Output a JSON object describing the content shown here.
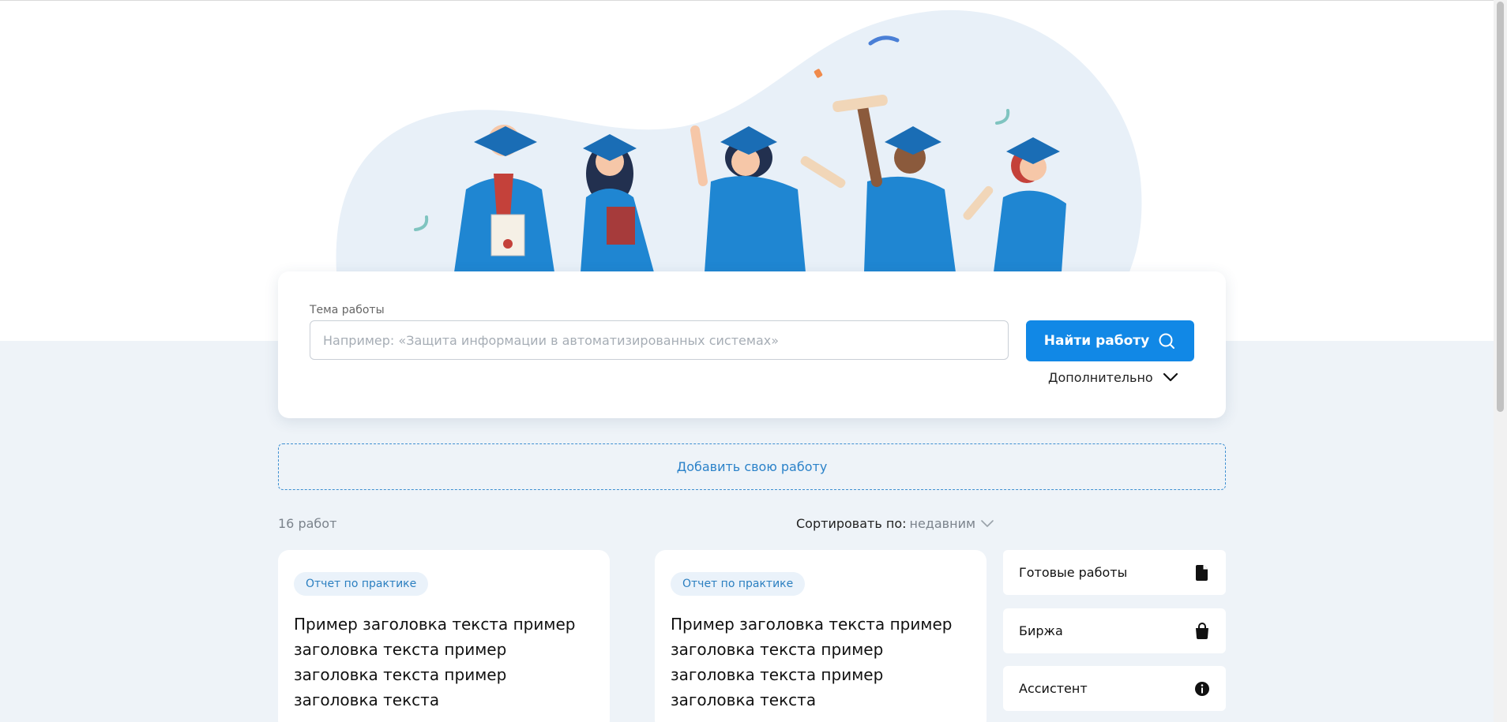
{
  "search": {
    "label": "Тема работы",
    "placeholder": "Например: «Защита информации в автоматизированных системах»",
    "value": "",
    "button_label": "Найти работу",
    "more_label": "Дополнительно"
  },
  "add_work_label": "Добавить свою работу",
  "results": {
    "count_label": "16 работ",
    "sort_label": "Сортировать по:",
    "sort_value": "недавним"
  },
  "cards": [
    {
      "tag": "Отчет по практике",
      "title": "Пример заголовка текста пример заголовка текста пример заголовка текста пример заголовка текста"
    },
    {
      "tag": "Отчет по практике",
      "title": "Пример заголовка текста пример заголовка текста пример заголовка текста пример заголовка текста"
    }
  ],
  "sidebar": {
    "items": [
      {
        "label": "Готовые работы",
        "icon": "document-icon"
      },
      {
        "label": "Биржа",
        "icon": "shopping-bag-icon"
      },
      {
        "label": "Ассистент",
        "icon": "info-icon"
      }
    ]
  },
  "colors": {
    "accent": "#1188e6",
    "background": "#eef3f8",
    "gown": "#1f86d2",
    "blob": "#e8f0f8"
  }
}
